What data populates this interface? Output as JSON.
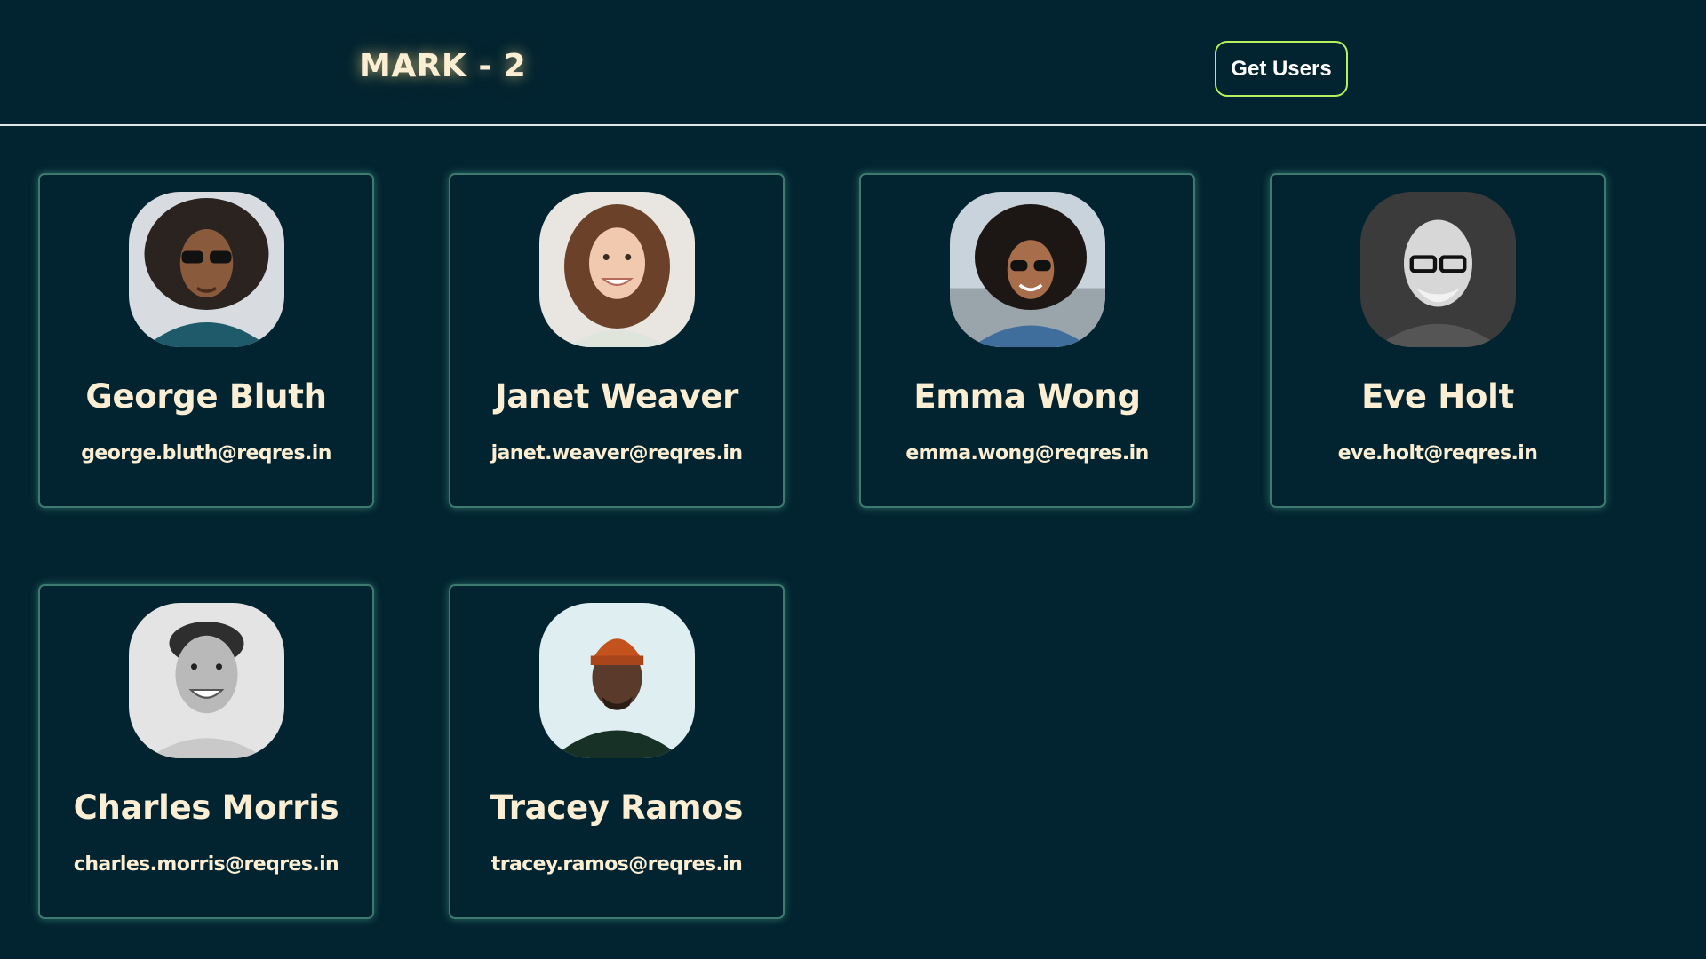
{
  "navbar": {
    "brand": "MARK - 2",
    "button_label": "Get Users"
  },
  "users": [
    {
      "name": "George Bluth",
      "email": "george.bluth@reqres.in",
      "avatar": "avatar-photo"
    },
    {
      "name": "Janet Weaver",
      "email": "janet.weaver@reqres.in",
      "avatar": "avatar-photo"
    },
    {
      "name": "Emma Wong",
      "email": "emma.wong@reqres.in",
      "avatar": "avatar-photo"
    },
    {
      "name": "Eve Holt",
      "email": "eve.holt@reqres.in",
      "avatar": "avatar-photo"
    },
    {
      "name": "Charles Morris",
      "email": "charles.morris@reqres.in",
      "avatar": "avatar-photo"
    },
    {
      "name": "Tracey Ramos",
      "email": "tracey.ramos@reqres.in",
      "avatar": "avatar-photo"
    }
  ],
  "colors": {
    "background": "#022330",
    "text": "#fbeed3",
    "button_border": "#b7f05a",
    "card_border": "#3e7a6f"
  }
}
